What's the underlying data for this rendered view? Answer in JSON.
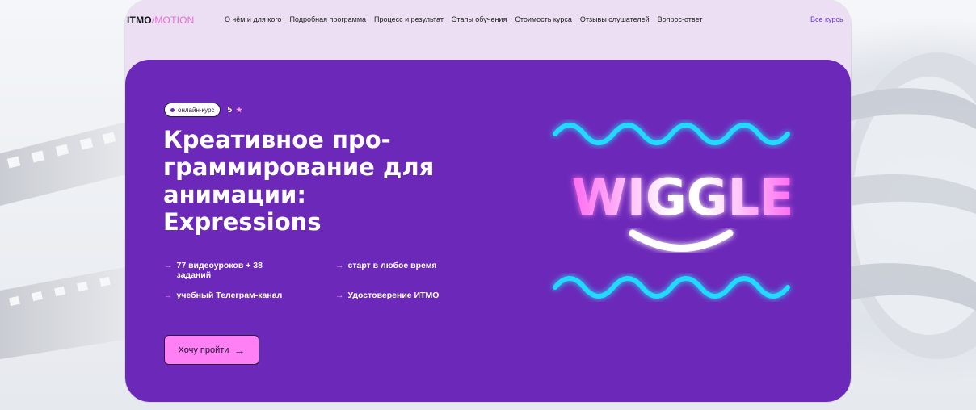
{
  "header": {
    "logo_main": "ITMO",
    "logo_sep": "/",
    "logo_sub": "MOTION",
    "nav": [
      "О чём и для кого",
      "Подробная программа",
      "Процесс и результат",
      "Этапы обучения",
      "Стоимость курса",
      "Отзывы слушателей",
      "Вопрос-ответ"
    ],
    "all_courses": "Все курсы"
  },
  "hero": {
    "badge": "онлайн-курс",
    "rating": "5",
    "title_lines": [
      "Креативное про-",
      "граммирование для",
      "анимации:",
      "Expressions"
    ],
    "features": [
      {
        "line1": "77 видеоуроков + 38",
        "line2": "заданий"
      },
      {
        "line1": "старт в любое время",
        "line2": ""
      },
      {
        "line1": "учебный Телеграм-канал",
        "line2": ""
      },
      {
        "line1": "Удостоверение ИТМО",
        "line2": ""
      }
    ],
    "cta_label": "Хочу пройти",
    "art_word": "WIGGLE"
  },
  "icons": {
    "star": "star-icon",
    "arrow": "arrow-right-icon"
  },
  "colors": {
    "hero_bg": "#6c28b8",
    "accent_pink": "#ff7ff4",
    "wave_cyan": "#21d9ff",
    "nav_bg": "#ecdff4"
  }
}
